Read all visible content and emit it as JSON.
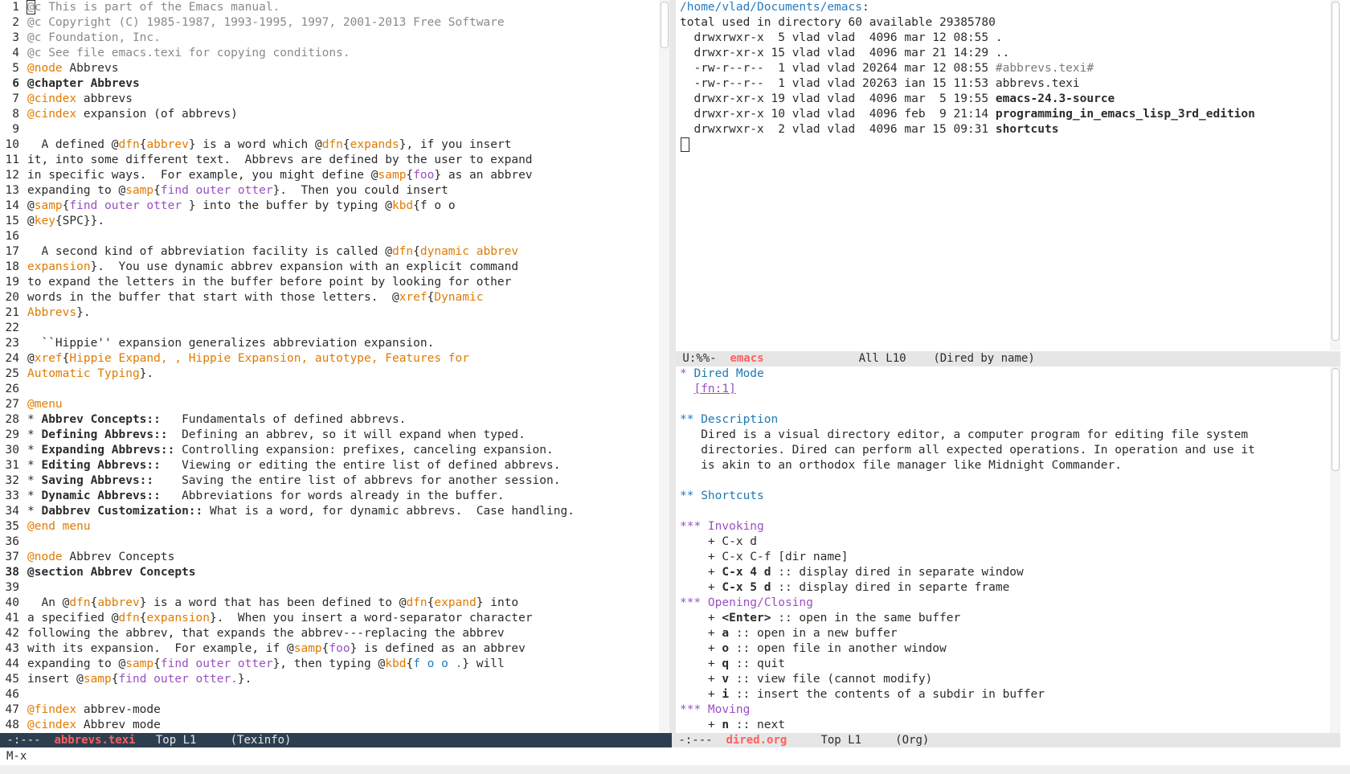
{
  "left": {
    "lines": [
      [
        {
          "t": "@c This is part of the Emacs manual.",
          "c": "cm"
        }
      ],
      [
        {
          "t": "@c Copyright (C) 1985-1987, 1993-1995, 1997, 2001-2013 Free Software",
          "c": "cm"
        }
      ],
      [
        {
          "t": "@c Foundation, Inc.",
          "c": "cm"
        }
      ],
      [
        {
          "t": "@c See file emacs.texi for copying conditions.",
          "c": "cm"
        }
      ],
      [
        {
          "t": "@node",
          "c": "kw"
        },
        {
          "t": " Abbrevs"
        }
      ],
      [
        {
          "t": "@chapter Abbrevs",
          "c": "bd"
        }
      ],
      [
        {
          "t": "@cindex",
          "c": "kw"
        },
        {
          "t": " abbrevs"
        }
      ],
      [
        {
          "t": "@cindex",
          "c": "kw"
        },
        {
          "t": " expansion (of abbrevs)"
        }
      ],
      [
        {
          "t": ""
        }
      ],
      [
        {
          "t": "  A defined @"
        },
        {
          "t": "dfn",
          "c": "kw"
        },
        {
          "t": "{"
        },
        {
          "t": "abbrev",
          "c": "arg"
        },
        {
          "t": "} is a word which @"
        },
        {
          "t": "dfn",
          "c": "kw"
        },
        {
          "t": "{"
        },
        {
          "t": "expands",
          "c": "arg"
        },
        {
          "t": "}, if you insert"
        }
      ],
      [
        {
          "t": "it, into some different text.  Abbrevs are defined by the user to expand"
        }
      ],
      [
        {
          "t": "in specific ways.  For example, you might define @"
        },
        {
          "t": "samp",
          "c": "kw"
        },
        {
          "t": "{"
        },
        {
          "t": "foo",
          "c": "pu"
        },
        {
          "t": "} as an abbrev"
        }
      ],
      [
        {
          "t": "expanding to @"
        },
        {
          "t": "samp",
          "c": "kw"
        },
        {
          "t": "{"
        },
        {
          "t": "find outer otter",
          "c": "pu"
        },
        {
          "t": "}.  Then you could insert"
        }
      ],
      [
        {
          "t": "@"
        },
        {
          "t": "samp",
          "c": "kw"
        },
        {
          "t": "{"
        },
        {
          "t": "find outer otter ",
          "c": "pu"
        },
        {
          "t": "} into the buffer by typing @"
        },
        {
          "t": "kbd",
          "c": "kw"
        },
        {
          "t": "{f o o"
        }
      ],
      [
        {
          "t": "@"
        },
        {
          "t": "key",
          "c": "kw"
        },
        {
          "t": "{SPC}}."
        }
      ],
      [
        {
          "t": ""
        }
      ],
      [
        {
          "t": "  A second kind of abbreviation facility is called @"
        },
        {
          "t": "dfn",
          "c": "kw"
        },
        {
          "t": "{"
        },
        {
          "t": "dynamic abbrev",
          "c": "arg"
        }
      ],
      [
        {
          "t": "expansion",
          "c": "arg"
        },
        {
          "t": "}.  You use dynamic abbrev expansion with an explicit command"
        }
      ],
      [
        {
          "t": "to expand the letters in the buffer before point by looking for other"
        }
      ],
      [
        {
          "t": "words in the buffer that start with those letters.  @"
        },
        {
          "t": "xref",
          "c": "kw"
        },
        {
          "t": "{"
        },
        {
          "t": "Dynamic",
          "c": "arg"
        }
      ],
      [
        {
          "t": "Abbrevs",
          "c": "arg"
        },
        {
          "t": "}."
        }
      ],
      [
        {
          "t": ""
        }
      ],
      [
        {
          "t": "  ``Hippie'' expansion generalizes abbreviation expansion."
        }
      ],
      [
        {
          "t": "@"
        },
        {
          "t": "xref",
          "c": "kw"
        },
        {
          "t": "{"
        },
        {
          "t": "Hippie Expand, , Hippie Expansion, autotype, Features for",
          "c": "arg"
        }
      ],
      [
        {
          "t": "Automatic Typing",
          "c": "arg"
        },
        {
          "t": "}."
        }
      ],
      [
        {
          "t": ""
        }
      ],
      [
        {
          "t": "@menu",
          "c": "kw"
        }
      ],
      [
        {
          "t": "* "
        },
        {
          "t": "Abbrev Concepts::",
          "c": "bd"
        },
        {
          "t": "   Fundamentals of defined abbrevs."
        }
      ],
      [
        {
          "t": "* "
        },
        {
          "t": "Defining Abbrevs::",
          "c": "bd"
        },
        {
          "t": "  Defining an abbrev, so it will expand when typed."
        }
      ],
      [
        {
          "t": "* "
        },
        {
          "t": "Expanding Abbrevs::",
          "c": "bd"
        },
        {
          "t": " Controlling expansion: prefixes, canceling expansion."
        }
      ],
      [
        {
          "t": "* "
        },
        {
          "t": "Editing Abbrevs::",
          "c": "bd"
        },
        {
          "t": "   Viewing or editing the entire list of defined abbrevs."
        }
      ],
      [
        {
          "t": "* "
        },
        {
          "t": "Saving Abbrevs::",
          "c": "bd"
        },
        {
          "t": "    Saving the entire list of abbrevs for another session."
        }
      ],
      [
        {
          "t": "* "
        },
        {
          "t": "Dynamic Abbrevs::",
          "c": "bd"
        },
        {
          "t": "   Abbreviations for words already in the buffer."
        }
      ],
      [
        {
          "t": "* "
        },
        {
          "t": "Dabbrev Customization::",
          "c": "bd"
        },
        {
          "t": " What is a word, for dynamic abbrevs.  Case handling."
        }
      ],
      [
        {
          "t": "@end menu",
          "c": "kw"
        }
      ],
      [
        {
          "t": ""
        }
      ],
      [
        {
          "t": "@node",
          "c": "kw"
        },
        {
          "t": " Abbrev Concepts"
        }
      ],
      [
        {
          "t": "@section Abbrev Concepts",
          "c": "bd"
        }
      ],
      [
        {
          "t": ""
        }
      ],
      [
        {
          "t": "  An @"
        },
        {
          "t": "dfn",
          "c": "kw"
        },
        {
          "t": "{"
        },
        {
          "t": "abbrev",
          "c": "arg"
        },
        {
          "t": "} is a word that has been defined to @"
        },
        {
          "t": "dfn",
          "c": "kw"
        },
        {
          "t": "{"
        },
        {
          "t": "expand",
          "c": "arg"
        },
        {
          "t": "} into"
        }
      ],
      [
        {
          "t": "a specified @"
        },
        {
          "t": "dfn",
          "c": "kw"
        },
        {
          "t": "{"
        },
        {
          "t": "expansion",
          "c": "arg"
        },
        {
          "t": "}.  When you insert a word-separator character"
        }
      ],
      [
        {
          "t": "following the abbrev, that expands the abbrev---replacing the abbrev"
        }
      ],
      [
        {
          "t": "with its expansion.  For example, if @"
        },
        {
          "t": "samp",
          "c": "kw"
        },
        {
          "t": "{"
        },
        {
          "t": "foo",
          "c": "pu"
        },
        {
          "t": "} is defined as an abbrev"
        }
      ],
      [
        {
          "t": "expanding to @"
        },
        {
          "t": "samp",
          "c": "kw"
        },
        {
          "t": "{"
        },
        {
          "t": "find outer otter",
          "c": "pu"
        },
        {
          "t": "}, then typing @"
        },
        {
          "t": "kbd",
          "c": "kw"
        },
        {
          "t": "{"
        },
        {
          "t": "f o o .",
          "c": "orgh2"
        },
        {
          "t": "} will"
        }
      ],
      [
        {
          "t": "insert @"
        },
        {
          "t": "samp",
          "c": "kw"
        },
        {
          "t": "{"
        },
        {
          "t": "find outer otter.",
          "c": "pu"
        },
        {
          "t": "}."
        }
      ],
      [
        {
          "t": ""
        }
      ],
      [
        {
          "t": "@findex",
          "c": "kw"
        },
        {
          "t": " abbrev-mode"
        }
      ],
      [
        {
          "t": "@cindex",
          "c": "kw"
        },
        {
          "t": " Abbrev mode"
        }
      ]
    ],
    "modeline": {
      "status": " -:---  ",
      "name": "abbrevs.texi",
      "pos": "   Top L1     ",
      "mode": "(Texinfo)"
    }
  },
  "dired": {
    "header": "/home/vlad/Documents/emacs",
    "header_suffix": ":",
    "summary": "total used in directory 60 available 29385780",
    "entries": [
      {
        "perm": "drwxrwxr-x",
        "meta": "  5 vlad vlad  4096 mar 12 08:55",
        "name": ".",
        "style": ""
      },
      {
        "perm": "drwxr-xr-x",
        "meta": " 15 vlad vlad  4096 mar 21 14:29",
        "name": "..",
        "style": ""
      },
      {
        "perm": "-rw-r--r--",
        "meta": "  1 vlad vlad 20264 mar 12 08:55",
        "name": "#abbrevs.texi#",
        "style": "dim"
      },
      {
        "perm": "-rw-r--r--",
        "meta": "  1 vlad vlad 20263 ian 15 11:53",
        "name": "abbrevs.texi",
        "style": ""
      },
      {
        "perm": "drwxr-xr-x",
        "meta": " 19 vlad vlad  4096 mar  5 19:55",
        "name": "emacs-24.3-source",
        "style": "bd"
      },
      {
        "perm": "drwxr-xr-x",
        "meta": " 10 vlad vlad  4096 feb  9 21:14",
        "name": "programming_in_emacs_lisp_3rd_edition",
        "style": "bd"
      },
      {
        "perm": "drwxrwxr-x",
        "meta": "  2 vlad vlad  4096 mar 15 09:31",
        "name": "shortcuts",
        "style": "bd"
      }
    ],
    "modeline": {
      "status": " U:%%-  ",
      "name": "emacs",
      "pos": "              All L10    ",
      "mode": "(Dired by name)"
    }
  },
  "org": {
    "lines": [
      [
        {
          "t": "* ",
          "c": "orgh1"
        },
        {
          "t": "Dired Mode",
          "c": "orgh2"
        }
      ],
      [
        {
          "t": "  "
        },
        {
          "t": "[fn:1]",
          "c": "link"
        }
      ],
      [
        {
          "t": ""
        }
      ],
      [
        {
          "t": "** Description",
          "c": "orgh2"
        }
      ],
      [
        {
          "t": "   Dired is a visual directory editor, a computer program for editing file system"
        }
      ],
      [
        {
          "t": "   directories. Dired can perform all expected operations. In operation and use it"
        }
      ],
      [
        {
          "t": "   is akin to an orthodox file manager like Midnight Commander."
        }
      ],
      [
        {
          "t": ""
        }
      ],
      [
        {
          "t": "** Shortcuts",
          "c": "orgh2"
        }
      ],
      [
        {
          "t": ""
        }
      ],
      [
        {
          "t": "*** Invoking",
          "c": "orgh3"
        }
      ],
      [
        {
          "t": "    + C-x d"
        }
      ],
      [
        {
          "t": "    + C-x C-f [dir name]"
        }
      ],
      [
        {
          "t": "    + "
        },
        {
          "t": "C-x 4 d",
          "c": "bd"
        },
        {
          "t": " :: display dired in separate window"
        }
      ],
      [
        {
          "t": "    + "
        },
        {
          "t": "C-x 5 d",
          "c": "bd"
        },
        {
          "t": " :: display dired in separte frame"
        }
      ],
      [
        {
          "t": "*** Opening/Closing",
          "c": "orgh3"
        }
      ],
      [
        {
          "t": "    + "
        },
        {
          "t": "<Enter>",
          "c": "bd"
        },
        {
          "t": " :: open in the same buffer"
        }
      ],
      [
        {
          "t": "    + "
        },
        {
          "t": "a",
          "c": "bd"
        },
        {
          "t": " :: open in a new buffer"
        }
      ],
      [
        {
          "t": "    + "
        },
        {
          "t": "o",
          "c": "bd"
        },
        {
          "t": " :: open file in another window"
        }
      ],
      [
        {
          "t": "    + "
        },
        {
          "t": "q",
          "c": "bd"
        },
        {
          "t": " :: quit"
        }
      ],
      [
        {
          "t": "    + "
        },
        {
          "t": "v",
          "c": "bd"
        },
        {
          "t": " :: view file (cannot modify)"
        }
      ],
      [
        {
          "t": "    + "
        },
        {
          "t": "i",
          "c": "bd"
        },
        {
          "t": " :: insert the contents of a subdir in buffer"
        }
      ],
      [
        {
          "t": "*** Moving",
          "c": "orgh3"
        }
      ],
      [
        {
          "t": "    + "
        },
        {
          "t": "n",
          "c": "bd"
        },
        {
          "t": " :: next"
        }
      ]
    ],
    "modeline": {
      "status": " -:---  ",
      "name": "dired.org",
      "pos": "     Top L1     ",
      "mode": "(Org)"
    }
  },
  "minibuffer": {
    "text": "M-x"
  }
}
